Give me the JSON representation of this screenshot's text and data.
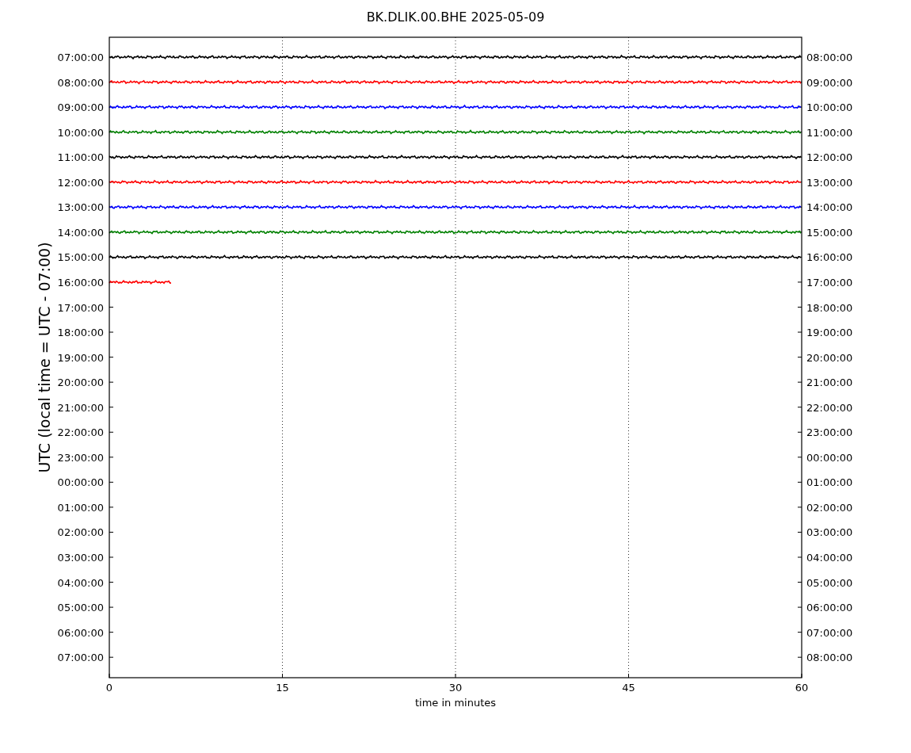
{
  "title": "BK.DLIK.00.BHE 2025-05-09",
  "ylabel": "UTC (local time = UTC - 07:00)",
  "xlabel": "time in minutes",
  "xticks": [
    "0",
    "15",
    "30",
    "45",
    "60"
  ],
  "rows": [
    {
      "left": "07:00:00",
      "right": "08:00:00",
      "trace": {
        "color": "#000000",
        "level": 1
      }
    },
    {
      "left": "08:00:00",
      "right": "09:00:00",
      "trace": {
        "color": "#ff0000",
        "level": 1
      }
    },
    {
      "left": "09:00:00",
      "right": "10:00:00",
      "trace": {
        "color": "#0000ff",
        "level": 1
      }
    },
    {
      "left": "10:00:00",
      "right": "11:00:00",
      "trace": {
        "color": "#008000",
        "level": 1
      }
    },
    {
      "left": "11:00:00",
      "right": "12:00:00",
      "trace": {
        "color": "#000000",
        "level": 1
      }
    },
    {
      "left": "12:00:00",
      "right": "13:00:00",
      "trace": {
        "color": "#ff0000",
        "level": 1
      }
    },
    {
      "left": "13:00:00",
      "right": "14:00:00",
      "trace": {
        "color": "#0000ff",
        "level": 1
      }
    },
    {
      "left": "14:00:00",
      "right": "15:00:00",
      "trace": {
        "color": "#008000",
        "level": 1
      }
    },
    {
      "left": "15:00:00",
      "right": "16:00:00",
      "trace": {
        "color": "#000000",
        "level": 1
      }
    },
    {
      "left": "16:00:00",
      "right": "17:00:00",
      "trace": {
        "color": "#ff0000",
        "level": 0.09
      }
    },
    {
      "left": "17:00:00",
      "right": "18:00:00"
    },
    {
      "left": "18:00:00",
      "right": "19:00:00"
    },
    {
      "left": "19:00:00",
      "right": "20:00:00"
    },
    {
      "left": "20:00:00",
      "right": "21:00:00"
    },
    {
      "left": "21:00:00",
      "right": "22:00:00"
    },
    {
      "left": "22:00:00",
      "right": "23:00:00"
    },
    {
      "left": "23:00:00",
      "right": "00:00:00"
    },
    {
      "left": "00:00:00",
      "right": "01:00:00"
    },
    {
      "left": "01:00:00",
      "right": "02:00:00"
    },
    {
      "left": "02:00:00",
      "right": "03:00:00"
    },
    {
      "left": "03:00:00",
      "right": "04:00:00"
    },
    {
      "left": "04:00:00",
      "right": "05:00:00"
    },
    {
      "left": "05:00:00",
      "right": "06:00:00"
    },
    {
      "left": "06:00:00",
      "right": "07:00:00"
    },
    {
      "left": "07:00:00",
      "right": "08:00:00"
    }
  ]
}
